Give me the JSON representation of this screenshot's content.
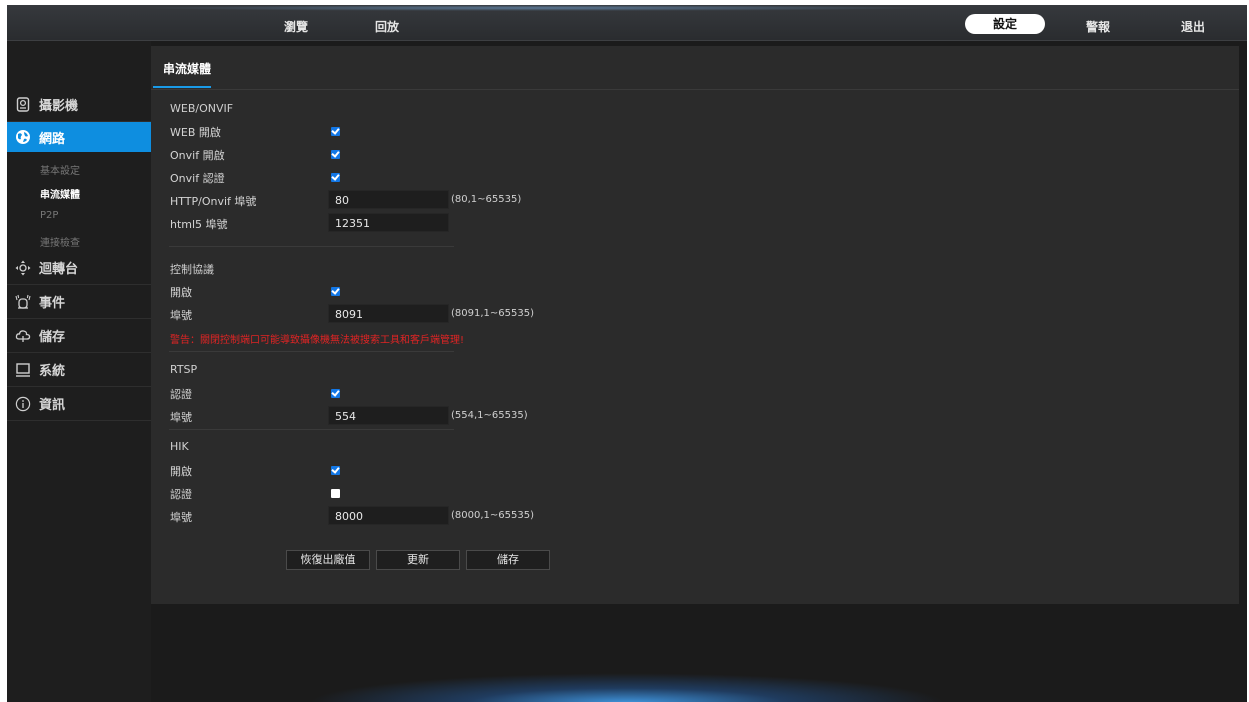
{
  "topnav": {
    "browse": "瀏覽",
    "playback": "回放",
    "settings": "設定",
    "alarm": "警報",
    "logout": "退出"
  },
  "sidebar": {
    "items": [
      {
        "label": "攝影機",
        "icon": "camera-icon"
      },
      {
        "label": "網路",
        "icon": "network-globe-icon"
      },
      {
        "label": "迴轉台",
        "icon": "ptz-icon"
      },
      {
        "label": "事件",
        "icon": "alarm-event-icon"
      },
      {
        "label": "儲存",
        "icon": "storage-icon"
      },
      {
        "label": "系統",
        "icon": "system-monitor-icon"
      },
      {
        "label": "資訊",
        "icon": "info-icon"
      }
    ],
    "network_sub": [
      "基本設定",
      "串流媒體",
      "P2P",
      "連接檢查"
    ]
  },
  "tab": "串流媒體",
  "web_onvif": {
    "title": "WEB/ONVIF",
    "web_enable": "WEB 開啟",
    "onvif_enable": "Onvif 開啟",
    "onvif_auth": "Onvif 認證",
    "http_port_label": "HTTP/Onvif 埠號",
    "http_port_value": "80",
    "http_port_range": "(80,1~65535)",
    "html5_port_label": "html5 埠號",
    "html5_port_value": "12351"
  },
  "control": {
    "title": "控制協議",
    "enable": "開啟",
    "port_label": "埠號",
    "port_value": "8091",
    "port_range": "(8091,1~65535)",
    "warning": "警告：關閉控制端口可能導致攝像機無法被搜索工具和客戶端管理!"
  },
  "rtsp": {
    "title": "RTSP",
    "auth": "認證",
    "port_label": "埠號",
    "port_value": "554",
    "port_range": "(554,1~65535)"
  },
  "hik": {
    "title": "HIK",
    "enable": "開啟",
    "auth": "認證",
    "port_label": "埠號",
    "port_value": "8000",
    "port_range": "(8000,1~65535)"
  },
  "buttons": {
    "restore": "恢復出廠值",
    "refresh": "更新",
    "save": "儲存"
  },
  "checkbox_states": {
    "web": true,
    "onvif": true,
    "onvif_auth": true,
    "control_enable": true,
    "rtsp_auth": true,
    "hik_enable": true,
    "hik_auth": false
  },
  "colors": {
    "accent": "#0e8ee0",
    "checkbox": "#1277e6",
    "warning": "#e02424"
  }
}
